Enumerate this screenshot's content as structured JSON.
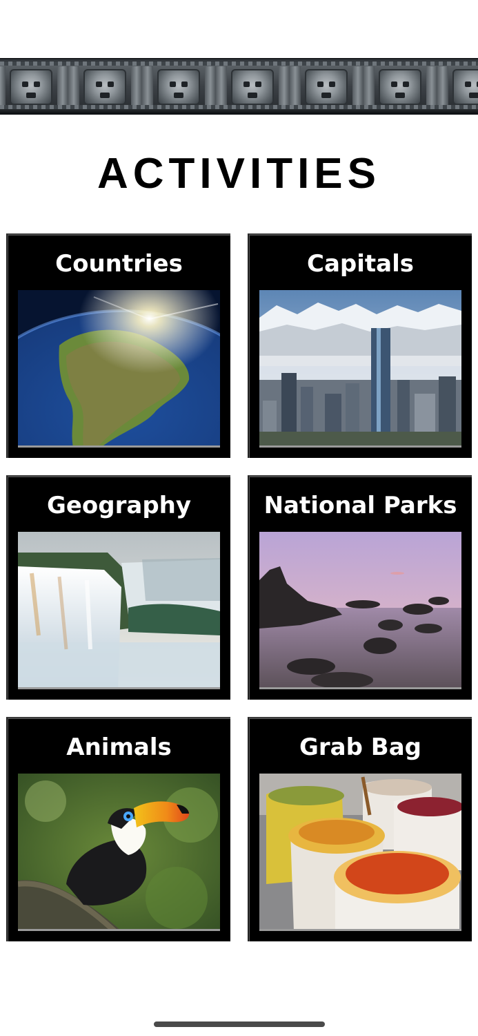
{
  "header": {
    "title": "ACTIVITIES"
  },
  "activities": [
    {
      "label": "Countries",
      "icon": "south-america-globe-image"
    },
    {
      "label": "Capitals",
      "icon": "city-skyline-mountains-image"
    },
    {
      "label": "Geography",
      "icon": "waterfall-image"
    },
    {
      "label": "National Parks",
      "icon": "rocky-coast-sunset-image"
    },
    {
      "label": "Animals",
      "icon": "toucan-image"
    },
    {
      "label": "Grab Bag",
      "icon": "spice-sacks-image"
    }
  ],
  "colors": {
    "background": "#ffffff",
    "card_background": "#000000",
    "card_text": "#ffffff",
    "title_text": "#000000"
  }
}
